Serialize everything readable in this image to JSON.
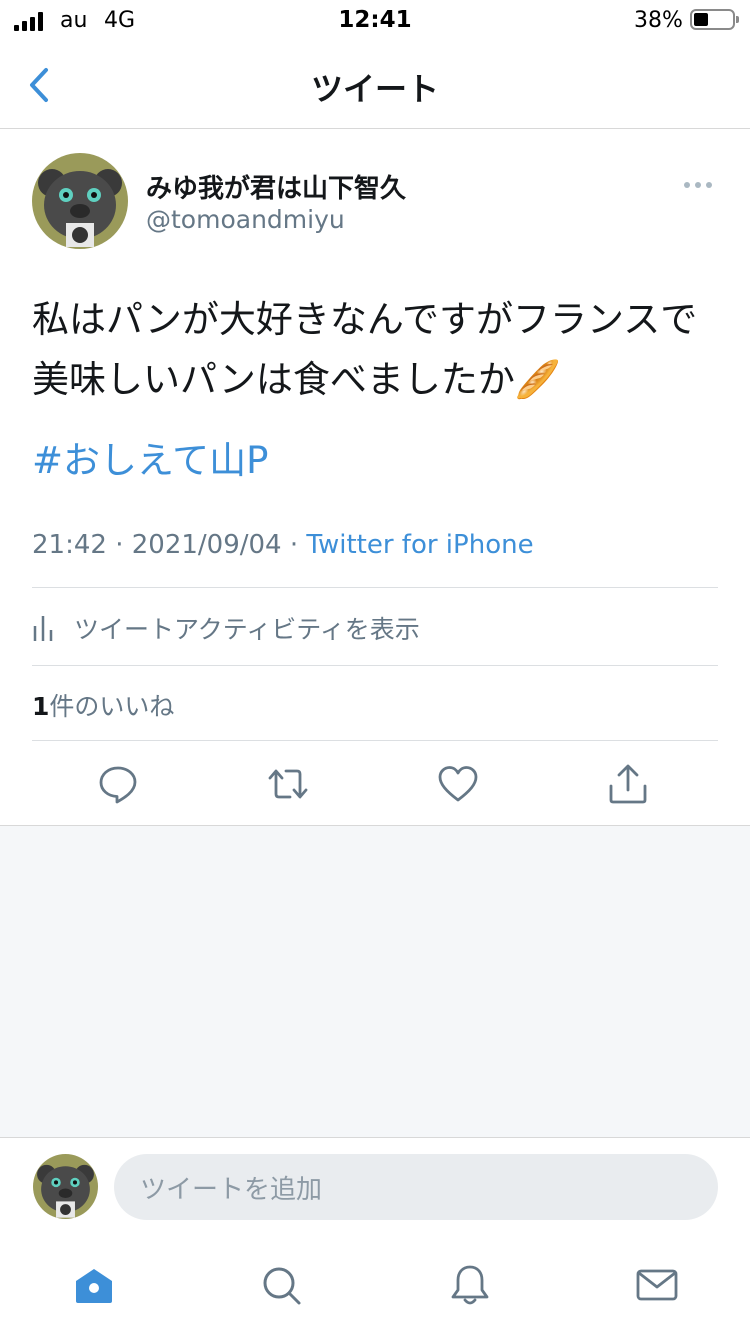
{
  "status_bar": {
    "carrier": "au",
    "network": "4G",
    "time": "12:41",
    "battery_percent": "38%",
    "battery_level": 0.38
  },
  "nav": {
    "title": "ツイート"
  },
  "tweet": {
    "display_name": "みゆ我が君は山下智久",
    "handle": "@tomoandmiyu",
    "text": "私はパンが大好きなんですがフランスで美味しいパンは食べましたか🥖",
    "hashtag": "#おしえて山P",
    "time": "21:42",
    "date": "2021/09/04",
    "separator": "·",
    "source": "Twitter for iPhone",
    "activity_label": "ツイートアクティビティを表示",
    "likes_count": "1",
    "likes_label": "件のいいね"
  },
  "reply": {
    "placeholder": "ツイートを追加"
  },
  "colors": {
    "accent": "#3d8fd8",
    "secondary_text": "#657786",
    "primary_text": "#14171a",
    "grey_background": "#f5f7f9"
  },
  "icons": {
    "back": "chevron-left-icon",
    "more": "more-horizontal-icon",
    "activity": "bar-chart-icon",
    "reply": "comment-icon",
    "retweet": "retweet-icon",
    "like": "heart-icon",
    "share": "share-icon",
    "home": "home-icon",
    "search": "search-icon",
    "notifications": "bell-icon",
    "messages": "mail-icon"
  }
}
